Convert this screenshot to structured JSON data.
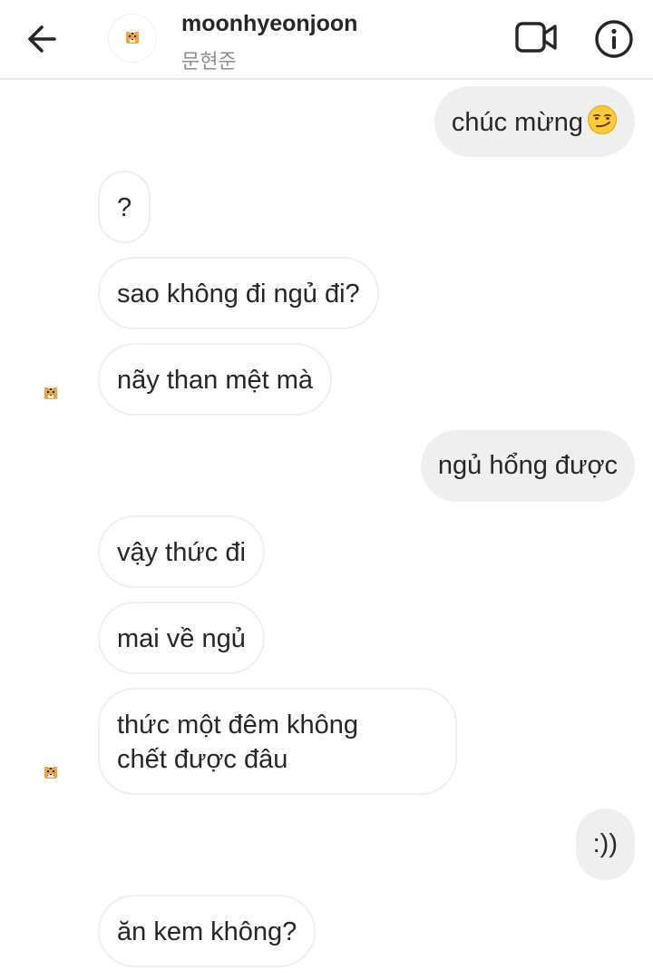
{
  "header": {
    "username": "moonhyeonjoon",
    "display_name": "문현준"
  },
  "messages": [
    {
      "side": "out",
      "text": "chúc mừng",
      "emoji": "smirking-face-emoji"
    },
    {
      "side": "in",
      "text": "?"
    },
    {
      "side": "in",
      "text": "sao không đi ngủ đi?"
    },
    {
      "side": "in",
      "text": "nãy than mệt mà"
    },
    {
      "side": "out",
      "text": "ngủ hổng được"
    },
    {
      "side": "in",
      "text": "vậy thức đi"
    },
    {
      "side": "in",
      "text": "mai về ngủ"
    },
    {
      "side": "in",
      "text": "thức một đêm không\nchết được đâu"
    },
    {
      "side": "out",
      "text": ":))"
    },
    {
      "side": "in",
      "text": "ăn kem không?"
    }
  ],
  "icons": {
    "back": "arrow-left-icon",
    "video_call": "video-camera-icon",
    "info": "info-icon",
    "avatar": "tiger-avatar-icon"
  },
  "colors": {
    "outgoing_bubble": "#efefef",
    "incoming_border": "#efefef",
    "subtext": "#8e8e8e"
  }
}
